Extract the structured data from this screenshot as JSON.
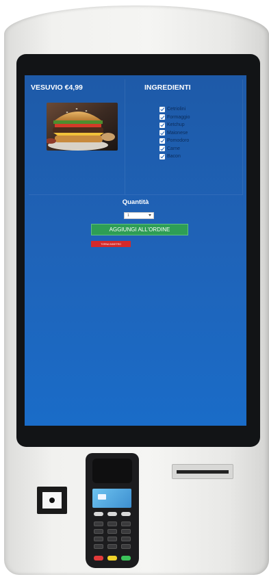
{
  "product": {
    "title": "VESUVIO €4,99",
    "image_alt": "burger-photo"
  },
  "ingredients": {
    "title": "INGREDIENTI",
    "items": [
      {
        "label": "Cetriolini",
        "checked": true
      },
      {
        "label": "Formaggio",
        "checked": true
      },
      {
        "label": "Ketchup",
        "checked": true
      },
      {
        "label": "Maionese",
        "checked": true
      },
      {
        "label": "Pomodoro",
        "checked": true
      },
      {
        "label": "Carne",
        "checked": true
      },
      {
        "label": "Bacon",
        "checked": true
      }
    ]
  },
  "quantity": {
    "label": "Quantità",
    "selected": "1"
  },
  "actions": {
    "add_label": "AGGIUNGI ALL'ORDINE",
    "back_label": "TORNA INDIETRO"
  },
  "colors": {
    "screen_bg": "#1f63b8",
    "add_button": "#2e9e55",
    "back_button": "#d42a2a"
  },
  "icons": {
    "checkbox": "check-icon",
    "select": "chevron-down-icon"
  }
}
